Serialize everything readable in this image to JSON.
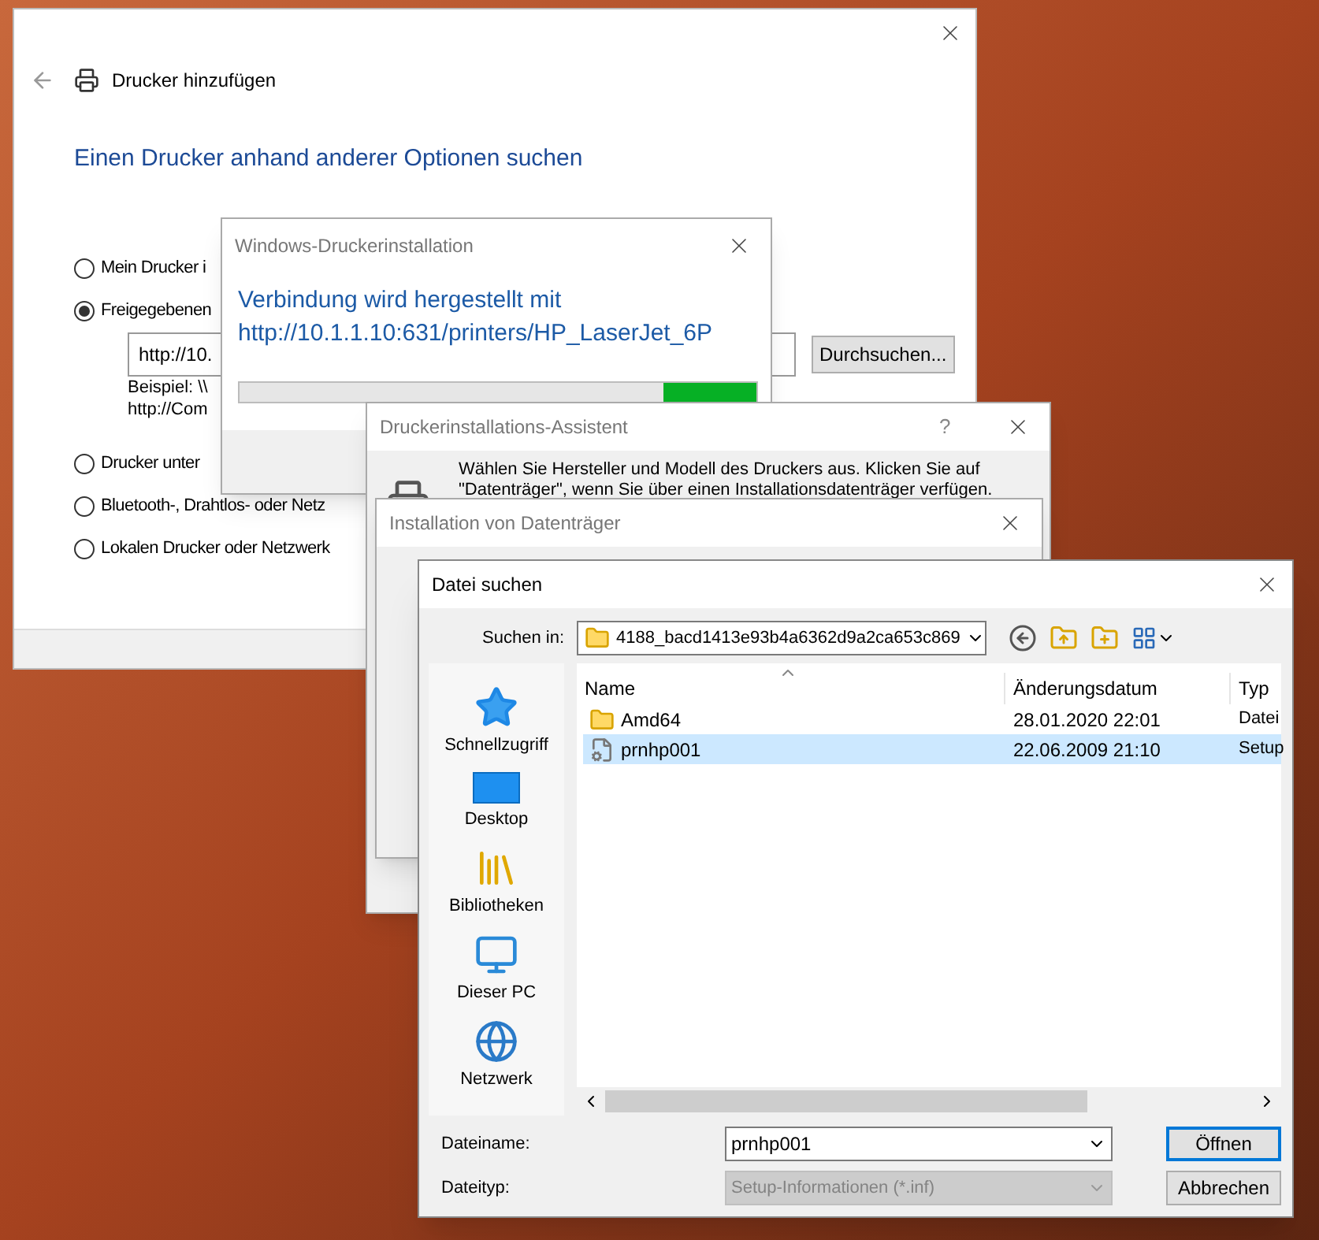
{
  "main_window": {
    "title": "Drucker hinzufügen",
    "heading": "Einen Drucker anhand anderer Optionen suchen",
    "options": [
      {
        "label": "Mein Drucker i",
        "selected": false
      },
      {
        "label": "Freigegebenen",
        "selected": true
      },
      {
        "label": "Drucker unter",
        "selected": false
      },
      {
        "label": "Bluetooth-, Drahtlos- oder Netz",
        "selected": false
      },
      {
        "label": "Lokalen Drucker oder Netzwerk",
        "selected": false
      }
    ],
    "url_field": {
      "value": "http://10."
    },
    "example_lines": [
      "Beispiel: \\\\",
      "http://Com"
    ],
    "browse_button": "Durchsuchen..."
  },
  "progress_dialog": {
    "title": "Windows-Druckerinstallation",
    "level": 0.18,
    "message_lines": [
      "Verbindung wird hergestellt mit",
      "http://10.1.1.10:631/printers/HP_LaserJet_6P"
    ]
  },
  "wizard_dialog": {
    "title": "Druckerinstallations-Assistent",
    "help": "?",
    "text_lines": [
      "Wählen Sie Hersteller und Modell des Druckers aus. Klicken Sie auf",
      "\"Datenträger\", wenn Sie über einen Installationsdatenträger verfügen."
    ]
  },
  "install_dialog": {
    "title": "Installation von Datenträger"
  },
  "file_dialog": {
    "title": "Datei suchen",
    "look_in_label": "Suchen in:",
    "look_in_value": "4188_bacd1413e93b4a6362d9a2ca653c869",
    "places": [
      {
        "label": "Schnellzugriff",
        "kind": "star"
      },
      {
        "label": "Desktop",
        "kind": "desktop"
      },
      {
        "label": "Bibliotheken",
        "kind": "library"
      },
      {
        "label": "Dieser PC",
        "kind": "pc"
      },
      {
        "label": "Netzwerk",
        "kind": "network"
      }
    ],
    "columns": [
      "Name",
      "Änderungsdatum",
      "Typ"
    ],
    "rows": [
      {
        "name": "Amd64",
        "date": "28.01.2020 22:01",
        "type": "Datei",
        "kind": "folder",
        "selected": false
      },
      {
        "name": "prnhp001",
        "date": "22.06.2009 21:10",
        "type": "Setup",
        "kind": "file",
        "selected": true
      }
    ],
    "filename_label": "Dateiname:",
    "filename_value": "prnhp001",
    "filetype_label": "Dateityp:",
    "filetype_value": "Setup-Informationen (*.inf)",
    "filetype_disabled": true,
    "buttons": [
      {
        "label": "Öffnen",
        "default": true
      },
      {
        "label": "Abbrechen",
        "default": false
      }
    ]
  }
}
